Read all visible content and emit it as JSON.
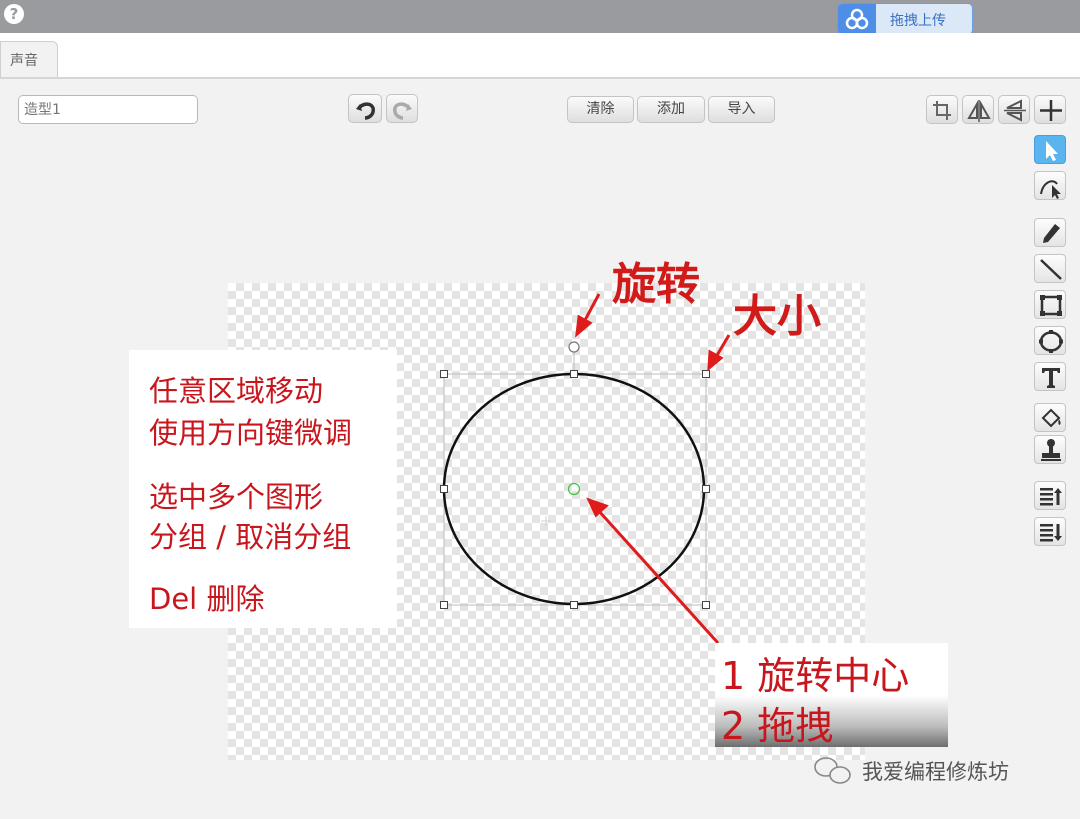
{
  "topbar": {
    "help_glyph": "?",
    "upload_label": "拖拽上传"
  },
  "tabs": [
    {
      "label": "声音"
    }
  ],
  "editor": {
    "costume_name_placeholder": "造型1",
    "buttons": {
      "clear": "清除",
      "add": "添加",
      "import": "导入"
    }
  },
  "icons": {
    "undo": "undo-icon",
    "redo": "redo-icon",
    "crop": "crop-icon",
    "flip_horizontal": "flip-horizontal-icon",
    "flip_vertical": "flip-vertical-icon",
    "set_center": "crosshair-icon",
    "tools": [
      "select-arrow-icon",
      "reshape-icon",
      "pencil-icon",
      "line-icon",
      "rectangle-icon",
      "ellipse-icon",
      "text-icon",
      "paint-bucket-icon",
      "stamp-icon",
      "bring-forward-icon",
      "send-backward-icon"
    ]
  },
  "annotations": {
    "rotate": "旋转",
    "size": "大小",
    "tips": [
      "任意区域移动",
      "使用方向键微调",
      "选中多个图形",
      "分组 / 取消分组",
      "Del 删除"
    ],
    "center_lines": [
      "1 旋转中心",
      "2 拖拽"
    ]
  },
  "watermark": "我爱编程修炼坊",
  "colors": {
    "accent": "#5ab4ef",
    "annotation_red": "#c8161d",
    "topbar": "#9a9b9e"
  }
}
